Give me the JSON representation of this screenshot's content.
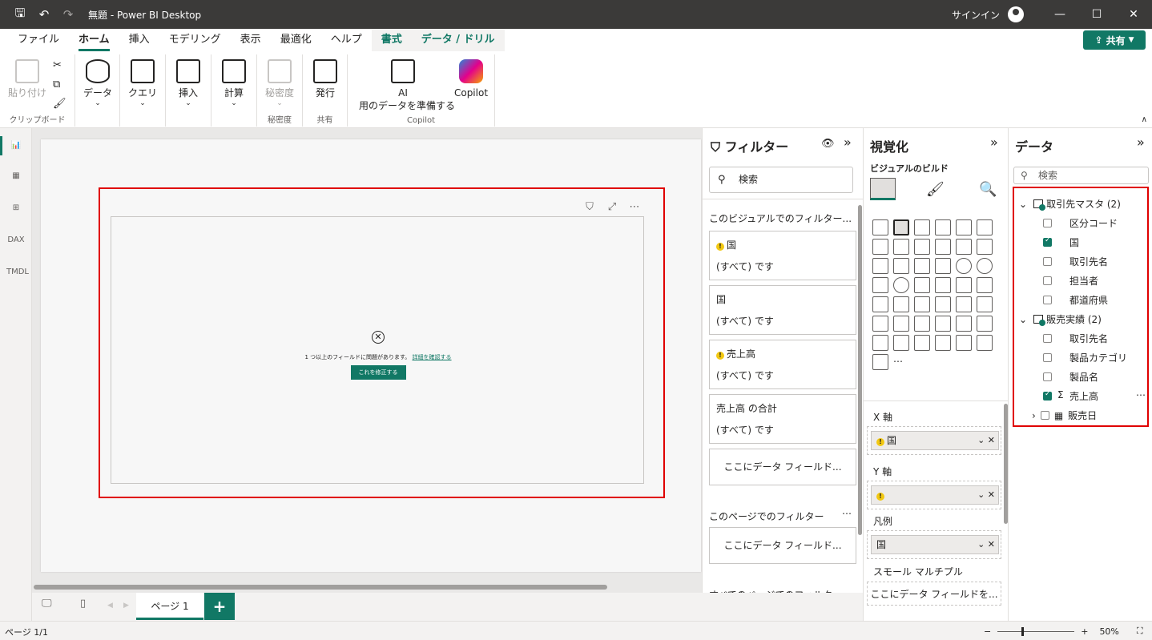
{
  "titlebar": {
    "title": "無題 - Power BI Desktop",
    "signin": "サインイン"
  },
  "menu": {
    "file": "ファイル",
    "home": "ホーム",
    "insert": "挿入",
    "modeling": "モデリング",
    "view": "表示",
    "optimize": "最適化",
    "help": "ヘルプ",
    "format": "書式",
    "data_drill": "データ / ドリル",
    "share": "共有"
  },
  "ribbon": {
    "paste": "貼り付け",
    "clipboard": "クリップボード",
    "data": "データ",
    "query": "クエリ",
    "insert": "挿入",
    "calc": "計算",
    "sensitivity": "秘密度",
    "sensitivity_group": "秘密度",
    "publish": "発行",
    "share_group": "共有",
    "ai": "AI",
    "ai_sub": "用のデータを準備する",
    "copilot": "Copilot",
    "copilot_group": "Copilot"
  },
  "visual": {
    "error": "1 つ以上のフィールドに問題があります。",
    "details": "詳細を確認する",
    "fix": "これを修正する"
  },
  "tabs": {
    "page1": "ページ 1",
    "add": "+"
  },
  "status": {
    "page": "ページ 1/1",
    "zoom": "50%"
  },
  "filters": {
    "title": "フィルター",
    "search": "検索",
    "section_visual": "このビジュアルでのフィルター...",
    "cards": [
      {
        "name": "国",
        "value": "(すべて) です",
        "warn": true
      },
      {
        "name": "国",
        "value": "(すべて) です",
        "warn": false
      },
      {
        "name": "売上高",
        "value": "(すべて) です",
        "warn": true
      },
      {
        "name": "売上高 の合計",
        "value": "(すべて) です",
        "warn": false
      }
    ],
    "drop": "ここにデータ フィールド...",
    "section_page": "このページでのフィルター",
    "drop2": "ここにデータ フィールド...",
    "section_all": "すべてのページでのフィルター"
  },
  "viz": {
    "title": "視覚化",
    "build": "ビジュアルのビルド",
    "xaxis": "X 軸",
    "xfield": "国",
    "yaxis": "Y 軸",
    "legend": "凡例",
    "legend_field": "国",
    "small": "スモール マルチプル",
    "small_drop": "ここにデータ フィールドを..."
  },
  "data": {
    "title": "データ",
    "search": "検索",
    "tables": [
      {
        "name": "取引先マスタ (2)",
        "fields": [
          {
            "name": "区分コード",
            "checked": false
          },
          {
            "name": "国",
            "checked": true
          },
          {
            "name": "取引先名",
            "checked": false
          },
          {
            "name": "担当者",
            "checked": false
          },
          {
            "name": "都道府県",
            "checked": false
          }
        ]
      },
      {
        "name": "販売実績 (2)",
        "fields": [
          {
            "name": "取引先名",
            "checked": false
          },
          {
            "name": "製品カテゴリ",
            "checked": false
          },
          {
            "name": "製品名",
            "checked": false
          },
          {
            "name": "売上高",
            "checked": true
          },
          {
            "name": "販売日",
            "checked": false
          }
        ]
      }
    ]
  }
}
